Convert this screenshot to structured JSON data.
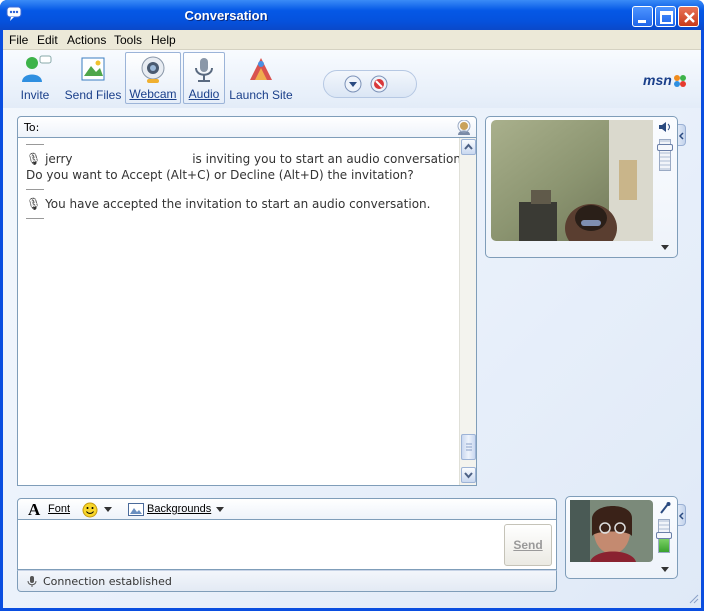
{
  "window": {
    "title": "Conversation"
  },
  "menu": [
    "File",
    "Edit",
    "Actions",
    "Tools",
    "Help"
  ],
  "toolbar": {
    "buttons": [
      {
        "label": "Invite",
        "icon": "invite-icon"
      },
      {
        "label": "Send Files",
        "icon": "send-files-icon"
      },
      {
        "label": "Webcam",
        "icon": "webcam-icon"
      },
      {
        "label": "Audio",
        "icon": "audio-icon"
      },
      {
        "label": "Launch Site",
        "icon": "launch-site-icon"
      }
    ],
    "brand": "msn"
  },
  "to_bar": {
    "label": "To:"
  },
  "chat": {
    "invite_sender": "jerry",
    "invite_text": "is inviting you to start an audio conversation.",
    "invite_question": "Do you want to Accept (Alt+C) or Decline (Alt+D) the invitation?",
    "accepted_text": "You have accepted the invitation to start an audio conversation."
  },
  "compose": {
    "font_label": "Font",
    "backgrounds_label": "Backgrounds",
    "send_label": "Send"
  },
  "status": {
    "text": "Connection established"
  },
  "colors": {
    "titlebar": "#0558e6",
    "panel_border": "#7f9db9",
    "link_blue": "#1a3f8a",
    "close_red": "#c83a1a"
  }
}
